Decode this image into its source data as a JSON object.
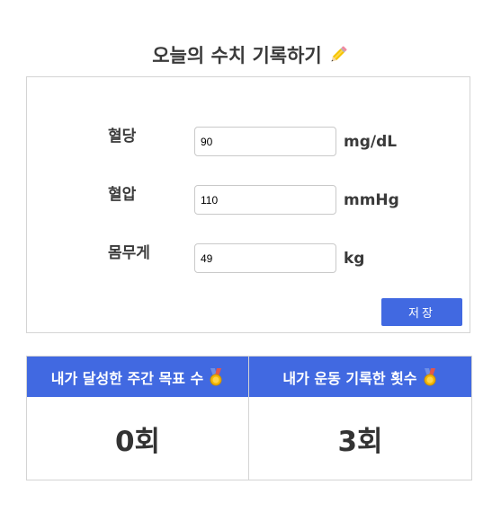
{
  "title": {
    "text": "오늘의 수치 기록하기",
    "icon": "pencil-icon"
  },
  "form": {
    "fields": [
      {
        "label": "혈당",
        "value": "90",
        "unit": "mg/dL"
      },
      {
        "label": "혈압",
        "value": "110",
        "unit": "mmHg"
      },
      {
        "label": "몸무게",
        "value": "49",
        "unit": "kg"
      }
    ],
    "save_label": "저장"
  },
  "stats": [
    {
      "header": "내가 달성한 주간 목표 수",
      "icon": "medal-icon",
      "value": "0회"
    },
    {
      "header": "내가 운동 기록한 횟수",
      "icon": "medal-icon",
      "value": "3회"
    }
  ],
  "colors": {
    "accent": "#4169e1",
    "border": "#d4d4d4",
    "text": "#3a3a3a"
  }
}
